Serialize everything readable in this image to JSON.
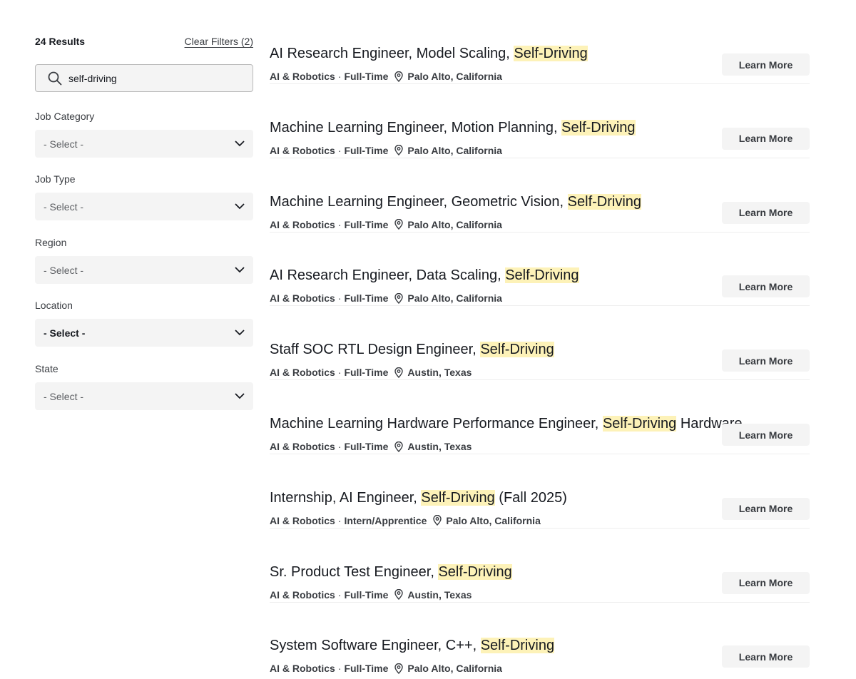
{
  "sidebar": {
    "results_count": "24 Results",
    "clear_filters": "Clear Filters (2)",
    "search": {
      "value": "self-driving",
      "icon": "search-icon"
    },
    "filters": [
      {
        "label": "Job Category",
        "value": "- Select -",
        "active": false
      },
      {
        "label": "Job Type",
        "value": "- Select -",
        "active": false
      },
      {
        "label": "Region",
        "value": "- Select -",
        "active": false
      },
      {
        "label": "Location",
        "value": "- Select -",
        "active": true
      },
      {
        "label": "State",
        "value": "- Select -",
        "active": false
      }
    ]
  },
  "jobs": [
    {
      "title_pre": "AI Research Engineer, Model Scaling, ",
      "title_hl": "Self-Driving",
      "title_post": "",
      "category": "AI & Robotics",
      "type": "Full-Time",
      "location": "Palo Alto, California",
      "button": "Learn More"
    },
    {
      "title_pre": "Machine Learning Engineer, Motion Planning, ",
      "title_hl": "Self-Driving",
      "title_post": "",
      "category": "AI & Robotics",
      "type": "Full-Time",
      "location": "Palo Alto, California",
      "button": "Learn More"
    },
    {
      "title_pre": "Machine Learning Engineer, Geometric Vision, ",
      "title_hl": "Self-Driving",
      "title_post": "",
      "category": "AI & Robotics",
      "type": "Full-Time",
      "location": "Palo Alto, California",
      "button": "Learn More"
    },
    {
      "title_pre": "AI Research Engineer, Data Scaling, ",
      "title_hl": "Self-Driving",
      "title_post": "",
      "category": "AI & Robotics",
      "type": "Full-Time",
      "location": "Palo Alto, California",
      "button": "Learn More"
    },
    {
      "title_pre": "Staff SOC RTL Design Engineer, ",
      "title_hl": "Self-Driving",
      "title_post": "",
      "category": "AI & Robotics",
      "type": "Full-Time",
      "location": "Austin, Texas",
      "button": "Learn More"
    },
    {
      "title_pre": "Machine Learning Hardware Performance Engineer, ",
      "title_hl": "Self-Driving",
      "title_post": " Hardware",
      "category": "AI & Robotics",
      "type": "Full-Time",
      "location": "Austin, Texas",
      "button": "Learn More"
    },
    {
      "title_pre": "Internship, AI Engineer, ",
      "title_hl": "Self-Driving",
      "title_post": " (Fall 2025)",
      "category": "AI & Robotics",
      "type": "Intern/Apprentice",
      "location": "Palo Alto, California",
      "button": "Learn More"
    },
    {
      "title_pre": "Sr. Product Test Engineer, ",
      "title_hl": "Self-Driving",
      "title_post": "",
      "category": "AI & Robotics",
      "type": "Full-Time",
      "location": "Austin, Texas",
      "button": "Learn More"
    },
    {
      "title_pre": "System Software Engineer, C++, ",
      "title_hl": "Self-Driving",
      "title_post": "",
      "category": "AI & Robotics",
      "type": "Full-Time",
      "location": "Palo Alto, California",
      "button": "Learn More"
    }
  ],
  "colors": {
    "highlight": "#fdf2b8",
    "button_bg": "#f4f4f4",
    "text": "#171a20"
  },
  "icons": {
    "location": "location-pin-icon",
    "dropdown": "chevron-down-icon"
  }
}
